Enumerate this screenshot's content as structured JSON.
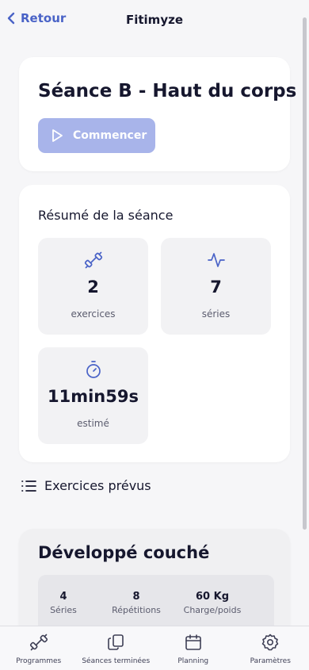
{
  "header": {
    "back_label": "Retour",
    "title": "Fitimyze"
  },
  "session": {
    "title": "Séance B - Haut du corps",
    "start_label": "Commencer"
  },
  "summary": {
    "title": "Résumé de la séance",
    "tiles": [
      {
        "icon": "dumbbell-icon",
        "value": "2",
        "label": "exercices"
      },
      {
        "icon": "activity-icon",
        "value": "7",
        "label": "séries"
      },
      {
        "icon": "timer-icon",
        "value": "11min59s",
        "label": "estimé"
      }
    ]
  },
  "exercises": {
    "heading": "Exercices prévus",
    "items": [
      {
        "name": "Développé couché",
        "stats": [
          {
            "value": "4",
            "label": "Séries"
          },
          {
            "value": "8",
            "label": "Répétitions"
          },
          {
            "value": "60 Kg",
            "label": "Charge/poids"
          }
        ]
      }
    ]
  },
  "tabbar": {
    "items": [
      {
        "icon": "dumbbell-icon",
        "label": "Programmes"
      },
      {
        "icon": "copy-icon",
        "label": "Séances terminées"
      },
      {
        "icon": "calendar-icon",
        "label": "Planning"
      },
      {
        "icon": "settings-icon",
        "label": "Paramètres"
      }
    ]
  },
  "colors": {
    "accent": "#4a63c7",
    "button_disabled": "#a8b4ea",
    "text": "#16172e"
  }
}
